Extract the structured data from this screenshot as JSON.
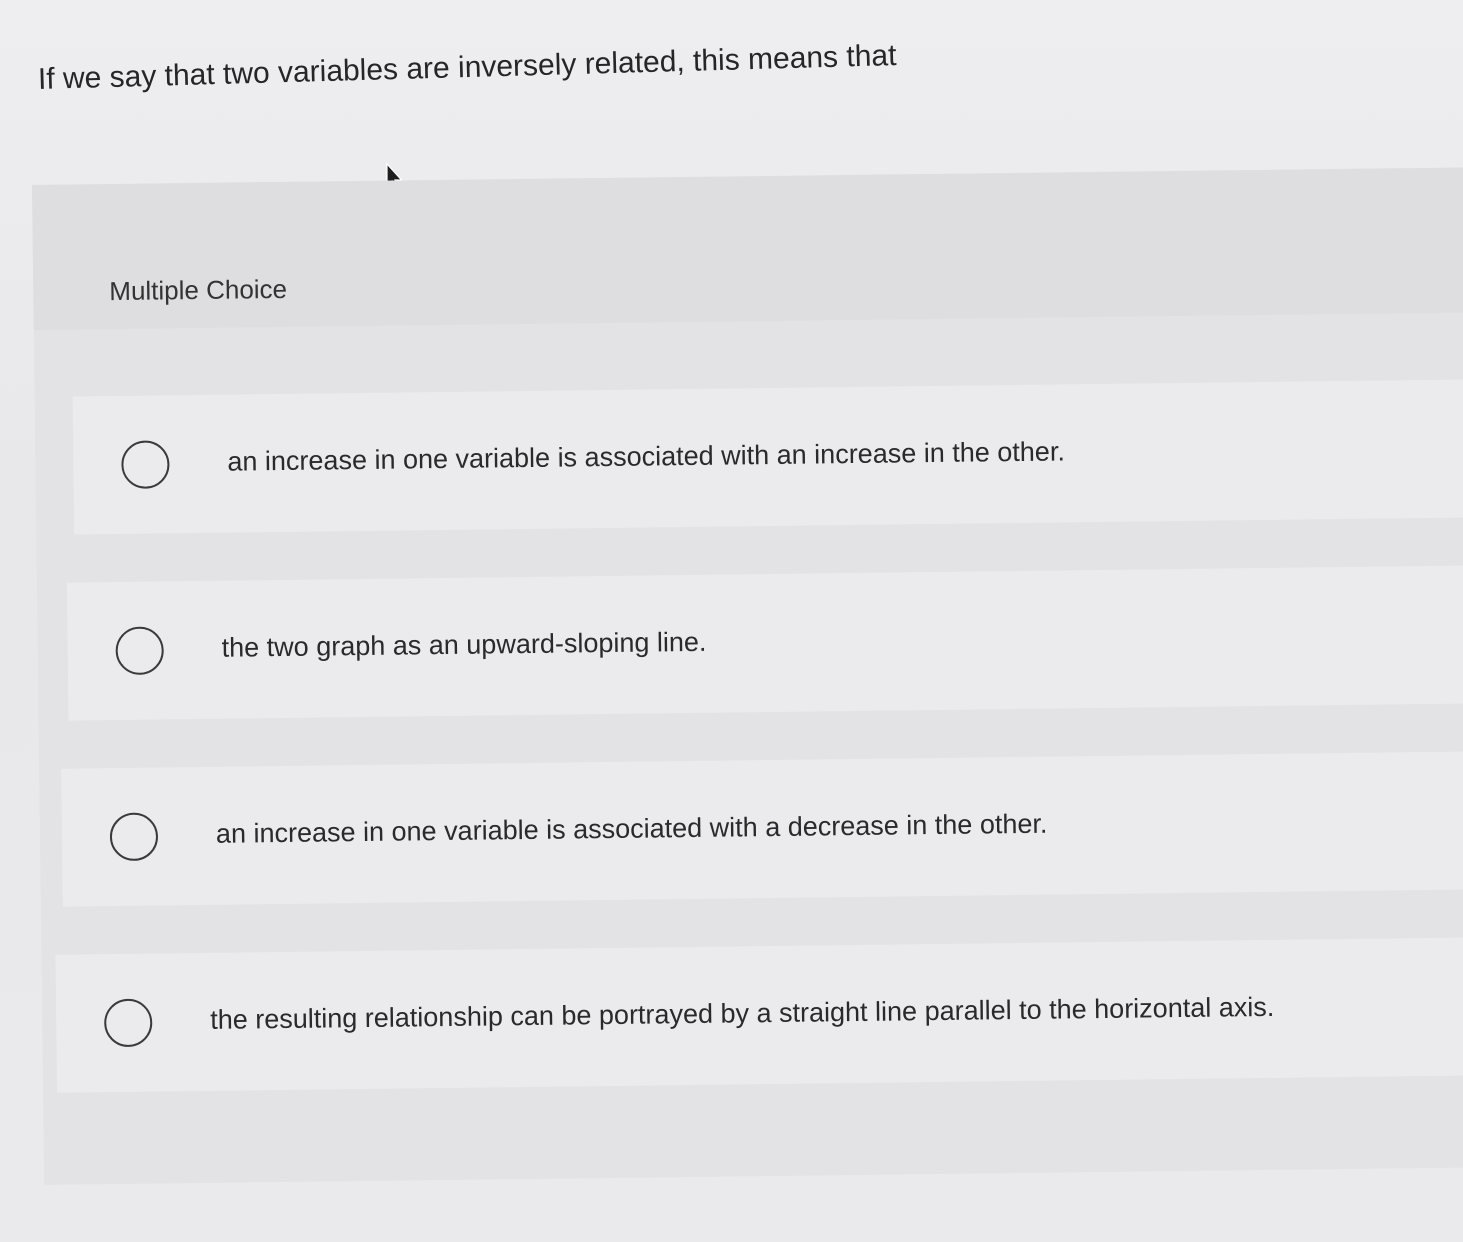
{
  "question": {
    "text": "If we say that two variables are inversely related, this means that"
  },
  "multiple_choice": {
    "label": "Multiple Choice",
    "options": [
      {
        "label": "an increase in one variable is associated with an increase in the other.",
        "selected": false
      },
      {
        "label": "the two graph as an upward-sloping line.",
        "selected": false
      },
      {
        "label": "an increase in one variable is associated with a decrease in the other.",
        "selected": false
      },
      {
        "label": "the resulting relationship can be portrayed by a straight line parallel to the horizontal axis.",
        "selected": false
      }
    ]
  },
  "icons": {
    "cursor": "mouse-pointer-icon",
    "radio": "radio-button-empty-icon"
  }
}
